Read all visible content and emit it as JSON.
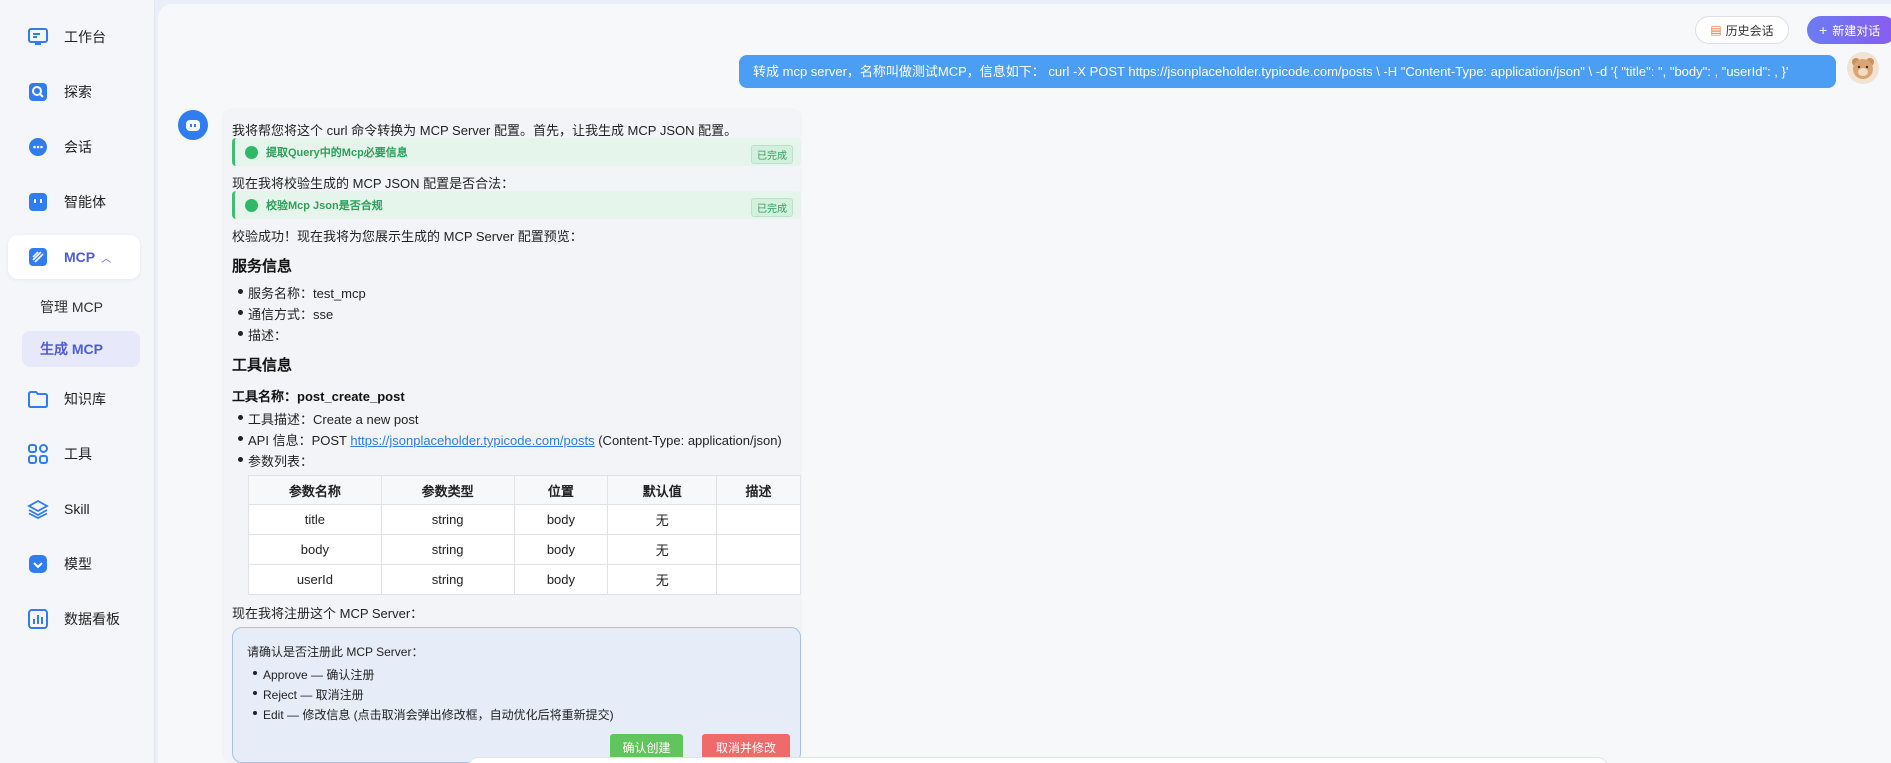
{
  "sidebar": {
    "items": [
      {
        "label": "工作台",
        "icon": "monitor-icon"
      },
      {
        "label": "探索",
        "icon": "search-icon"
      },
      {
        "label": "会话",
        "icon": "chat-icon"
      },
      {
        "label": "智能体",
        "icon": "robot-icon"
      },
      {
        "label": "MCP",
        "icon": "mcp-icon"
      },
      {
        "label": "知识库",
        "icon": "folder-icon"
      },
      {
        "label": "工具",
        "icon": "grid-icon"
      },
      {
        "label": "Skill",
        "icon": "layers-icon"
      },
      {
        "label": "模型",
        "icon": "model-icon"
      },
      {
        "label": "数据看板",
        "icon": "chart-icon"
      }
    ],
    "mcp_sub": [
      {
        "label": "管理 MCP"
      },
      {
        "label": "生成 MCP"
      }
    ],
    "accent": "#4f5bd5"
  },
  "header": {
    "history_label": "历史会话",
    "new_chat_label": "新建对话"
  },
  "chat": {
    "user_message": "转成 mcp server，名称叫做测试MCP，信息如下： curl -X POST https://jsonplaceholder.typicode.com/posts \\ -H \"Content-Type: application/json\" \\ -d '{ \"title\": \", \"body\": , \"userId\": , }'",
    "bot": {
      "line1": "我将帮您将这个 curl 命令转换为 MCP Server 配置。首先，让我生成 MCP JSON 配置。",
      "step1_name": "提取Query中的Mcp必要信息",
      "step1_status": "已完成",
      "line2": "现在我将校验生成的 MCP JSON 配置是否合法：",
      "step2_name": "校验Mcp Json是否合规",
      "step2_status": "已完成",
      "line3": "校验成功！现在我将为您展示生成的 MCP Server 配置预览：",
      "service_heading": "服务信息",
      "service_items": [
        "服务名称：test_mcp",
        "通信方式：sse",
        "描述："
      ],
      "tool_heading": "工具信息",
      "tool_name_label": "工具名称：post_create_post",
      "tool_desc": "工具描述：Create a new post",
      "api_prefix": "API 信息：POST ",
      "api_url": "https://jsonplaceholder.typicode.com/posts",
      "api_suffix": " (Content-Type: application/json)",
      "params_label": "参数列表：",
      "table": {
        "headers": [
          "参数名称",
          "参数类型",
          "位置",
          "默认值",
          "描述"
        ],
        "rows": [
          [
            "title",
            "string",
            "body",
            "无",
            ""
          ],
          [
            "body",
            "string",
            "body",
            "无",
            ""
          ],
          [
            "userId",
            "string",
            "body",
            "无",
            ""
          ]
        ]
      },
      "line4": "现在我将注册这个 MCP Server：",
      "confirm": {
        "title": "请确认是否注册此 MCP Server：",
        "items": [
          "Approve — 确认注册",
          "Reject — 取消注册",
          "Edit — 修改信息 (点击取消会弹出修改框，自动优化后将重新提交)"
        ],
        "ok_label": "确认创建",
        "cancel_label": "取消并修改"
      }
    }
  }
}
